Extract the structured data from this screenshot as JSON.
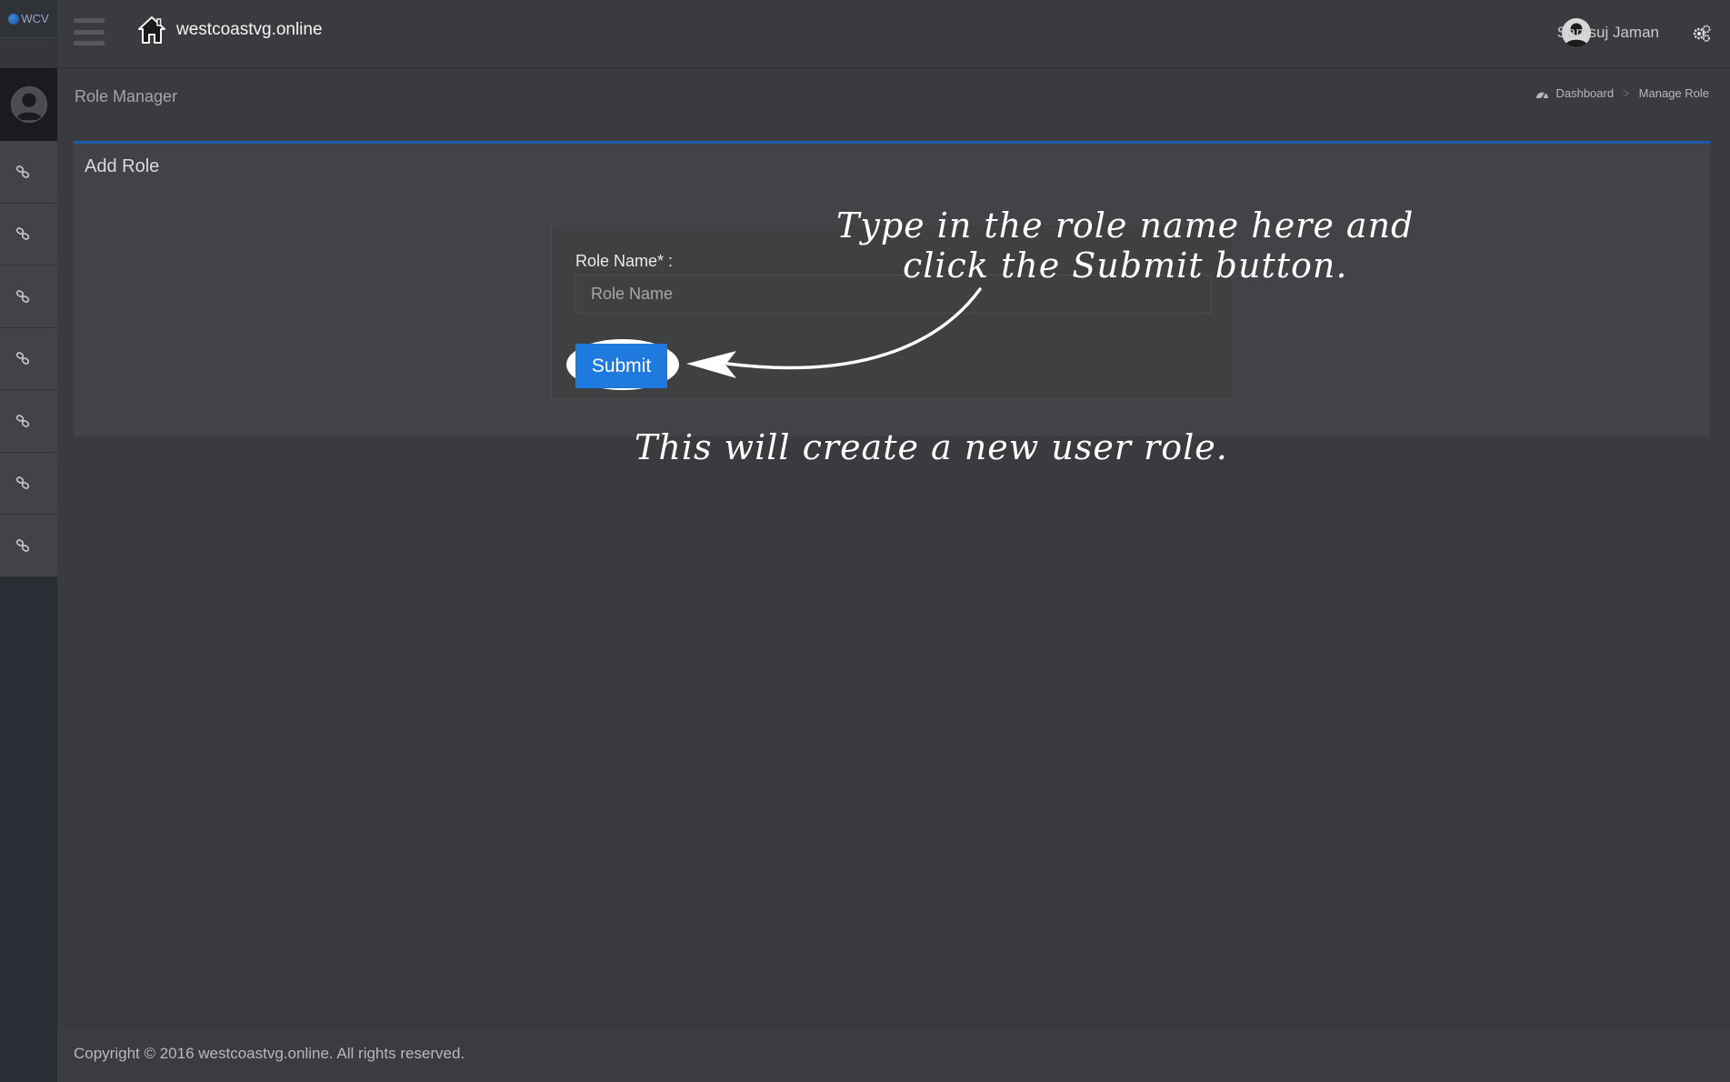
{
  "app": {
    "logo_text": "WCV",
    "site_title": "westcoastvg.online"
  },
  "topbar": {
    "user_name": "Samsuj Jaman"
  },
  "sidebar": {
    "items": [
      {
        "icon": "link-icon"
      },
      {
        "icon": "link-icon"
      },
      {
        "icon": "link-icon"
      },
      {
        "icon": "link-icon"
      },
      {
        "icon": "link-icon"
      },
      {
        "icon": "link-icon"
      },
      {
        "icon": "link-icon"
      }
    ]
  },
  "header": {
    "page_title": "Role Manager",
    "breadcrumb": [
      "Dashboard",
      "Manage Role"
    ],
    "breadcrumb_separator": ">"
  },
  "panel": {
    "title": "Add Role",
    "form": {
      "role_label": "Role Name* :",
      "role_placeholder": "Role Name",
      "role_value": "",
      "submit_label": "Submit"
    }
  },
  "annotations": {
    "line1": "Type in the role name here and",
    "line2": "click the Submit button.",
    "note": "This will create a new user role."
  },
  "footer": {
    "copyright": "Copyright © 2016 westcoastvg.online. All rights reserved."
  },
  "colors": {
    "accent": "#1f7ae0",
    "panel_top_border": "#1e5aa8",
    "background": "#3a3b3e"
  }
}
